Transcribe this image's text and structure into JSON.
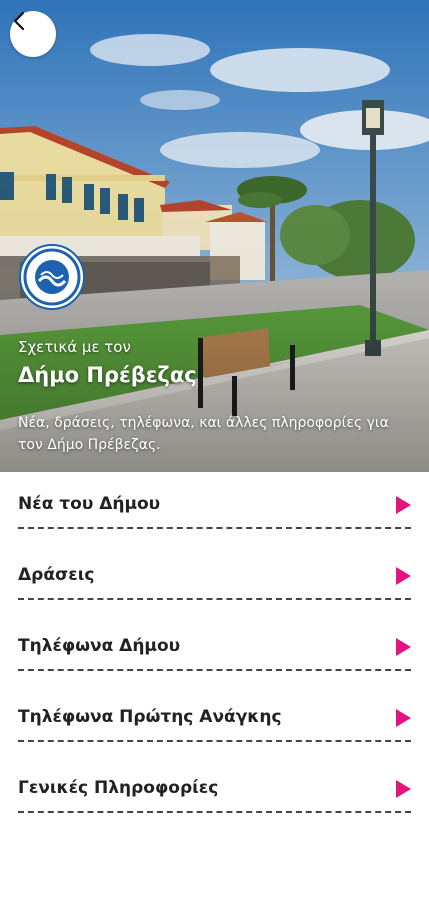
{
  "header": {
    "back_icon": "chevron-left-icon",
    "logo": "municipality-logo",
    "subtitle": "Σχετικά με τον",
    "title": "Δήμο Πρέβεζας",
    "description": "Νέα, δράσεις, τηλέφωνα, και άλλες πληροφορίες για τον Δήμο Πρέβεζας."
  },
  "menu": {
    "arrow_color": "#e3137f",
    "items": [
      {
        "label": "Νέα του Δήμου"
      },
      {
        "label": "Δράσεις"
      },
      {
        "label": "Τηλέφωνα Δήμου"
      },
      {
        "label": "Τηλέφωνα Πρώτης Ανάγκης"
      },
      {
        "label": "Γενικές Πληροφορίες"
      }
    ]
  }
}
